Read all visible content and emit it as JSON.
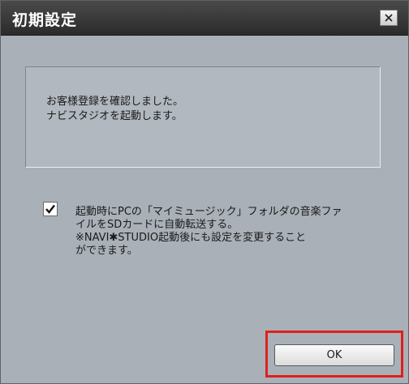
{
  "window": {
    "title": "初期設定",
    "close_label": "×"
  },
  "message": {
    "line1": "お客様登録を確認しました。",
    "line2": "ナビスタジオを起動します。"
  },
  "option": {
    "checked": true,
    "line1": "起動時にPCの「マイミュージック」フォルダの音楽ファ",
    "line2": "イルをSDカードに自動転送する。",
    "line3": "※NAVI✱STUDIO起動後にも設定を変更すること",
    "line4": "ができます。"
  },
  "buttons": {
    "ok_label": "OK"
  },
  "colors": {
    "titlebar": "#333333",
    "body": "#a9b0b7",
    "highlight": "#e0201e"
  }
}
